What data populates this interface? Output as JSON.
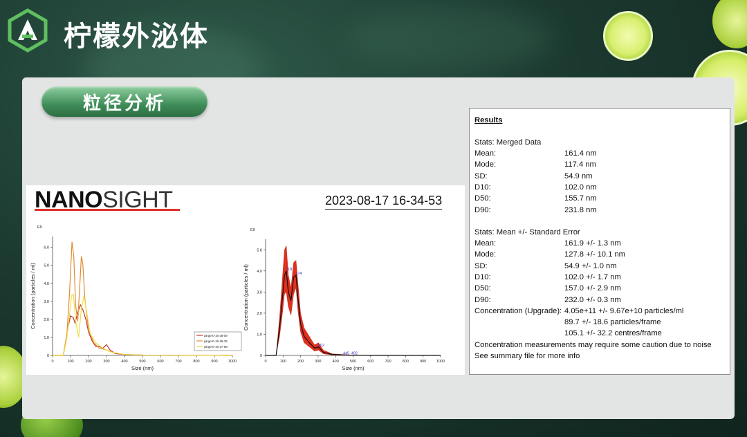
{
  "header": {
    "title": "柠檬外泌体"
  },
  "section": {
    "label": "粒径分析"
  },
  "report": {
    "logo_bold": "NANO",
    "logo_light": "SIGHT",
    "timestamp": "2023-08-17 16-34-53"
  },
  "chart_data": [
    {
      "type": "line",
      "xlabel": "Size (nm)",
      "ylabel": "Concentration (particles / ml)",
      "y_multiplier": "E9",
      "xlim": [
        0,
        1000
      ],
      "ylim": [
        0,
        6.6
      ],
      "xticks": [
        0,
        100,
        200,
        300,
        400,
        500,
        600,
        700,
        800,
        900,
        1000
      ],
      "yticks": [
        0,
        1.0,
        2.0,
        3.0,
        4.0,
        5.0,
        6.0
      ],
      "legend_position": "lower-right",
      "series": [
        {
          "name": "ginger0-16-35-09",
          "color": "#c03838",
          "x": [
            0,
            60,
            85,
            100,
            115,
            125,
            140,
            155,
            170,
            185,
            200,
            220,
            240,
            260,
            280,
            300,
            320,
            350,
            400,
            500,
            1000
          ],
          "y": [
            0,
            0,
            1.5,
            2.2,
            2.1,
            1.8,
            2.4,
            2.8,
            2.5,
            2.0,
            1.3,
            0.8,
            0.5,
            0.5,
            0.4,
            0.6,
            0.3,
            0.1,
            0.05,
            0.02,
            0
          ]
        },
        {
          "name": "ginger0-16-36-36",
          "color": "#e08a35",
          "x": [
            0,
            60,
            80,
            95,
            108,
            118,
            128,
            140,
            150,
            160,
            168,
            180,
            200,
            230,
            260,
            300,
            340,
            400,
            500,
            1000
          ],
          "y": [
            0,
            0,
            1.2,
            3.6,
            6.3,
            5.5,
            2.8,
            1.9,
            3.6,
            5.5,
            5.1,
            3.1,
            1.4,
            0.7,
            0.4,
            0.3,
            0.15,
            0.05,
            0.02,
            0
          ]
        },
        {
          "name": "ginger0-16-37-58",
          "color": "#f0de44",
          "x": [
            0,
            60,
            80,
            95,
            105,
            115,
            130,
            145,
            160,
            175,
            190,
            210,
            240,
            280,
            320,
            400,
            500,
            1000
          ],
          "y": [
            0,
            0,
            1.0,
            2.3,
            3.3,
            3.4,
            1.8,
            1.0,
            2.6,
            3.3,
            2.4,
            1.2,
            0.7,
            0.4,
            0.2,
            0.05,
            0.02,
            0
          ]
        }
      ]
    },
    {
      "type": "area",
      "xlabel": "Size (nm)",
      "ylabel": "Concentration (particles / ml)",
      "y_multiplier": "E9",
      "xlim": [
        0,
        1000
      ],
      "ylim": [
        0,
        5.5
      ],
      "xticks": [
        0,
        100,
        200,
        300,
        400,
        500,
        600,
        700,
        800,
        900,
        1000
      ],
      "yticks": [
        0,
        1.0,
        2.0,
        3.0,
        4.0,
        5.0
      ],
      "peak_labels": [
        "118",
        "174",
        "302",
        "445",
        "492"
      ],
      "mean": {
        "x": [
          0,
          60,
          80,
          95,
          108,
          118,
          130,
          145,
          160,
          174,
          185,
          200,
          220,
          250,
          280,
          302,
          330,
          380,
          445,
          492,
          600,
          1000
        ],
        "y": [
          0,
          0,
          1.3,
          2.6,
          3.8,
          4.0,
          3.0,
          2.6,
          3.7,
          3.8,
          2.7,
          1.5,
          0.9,
          0.6,
          0.35,
          0.4,
          0.15,
          0.05,
          0.02,
          0.01,
          0,
          0
        ]
      },
      "error": {
        "x": [
          0,
          60,
          80,
          95,
          108,
          118,
          130,
          145,
          160,
          174,
          185,
          200,
          220,
          250,
          280,
          302,
          330,
          380,
          445,
          492,
          600,
          1000
        ],
        "lower": [
          0,
          0,
          0.9,
          1.9,
          2.9,
          3.0,
          2.3,
          1.9,
          2.9,
          3.2,
          2.1,
          1.1,
          0.6,
          0.4,
          0.2,
          0.25,
          0.08,
          0.02,
          0.01,
          0,
          0,
          0
        ],
        "upper": [
          0,
          0,
          1.8,
          3.5,
          5.0,
          5.2,
          3.8,
          3.2,
          4.4,
          4.5,
          3.4,
          2.0,
          1.3,
          0.9,
          0.5,
          0.6,
          0.25,
          0.08,
          0.04,
          0.02,
          0,
          0
        ]
      }
    }
  ],
  "results": {
    "heading": "Results",
    "merged_title": "Stats: Merged Data",
    "merged": [
      {
        "label": "Mean:",
        "value": "161.4 nm"
      },
      {
        "label": "Mode:",
        "value": "117.4 nm"
      },
      {
        "label": "SD:",
        "value": "54.9 nm"
      },
      {
        "label": "D10:",
        "value": "102.0 nm"
      },
      {
        "label": "D50:",
        "value": "155.7 nm"
      },
      {
        "label": "D90:",
        "value": "231.8 nm"
      }
    ],
    "mean_title": "Stats: Mean +/- Standard Error",
    "mean_stats": [
      {
        "label": "Mean:",
        "value": "161.9 +/- 1.3 nm"
      },
      {
        "label": "Mode:",
        "value": "127.8 +/- 10.1 nm"
      },
      {
        "label": "SD:",
        "value": "54.9 +/- 1.0 nm"
      },
      {
        "label": "D10:",
        "value": "102.0 +/- 1.7 nm"
      },
      {
        "label": "D50:",
        "value": "157.0 +/- 2.9 nm"
      },
      {
        "label": "D90:",
        "value": "232.0 +/- 0.3 nm"
      }
    ],
    "concentration_label": "Concentration (Upgrade):",
    "concentration_values": [
      "4.05e+11 +/- 9.67e+10 particles/ml",
      "89.7 +/- 18.6 particles/frame",
      "105.1 +/- 32.2 centres/frame"
    ],
    "notes": [
      "Concentration measurements may require some caution due to noise",
      "See summary file for more info"
    ]
  }
}
